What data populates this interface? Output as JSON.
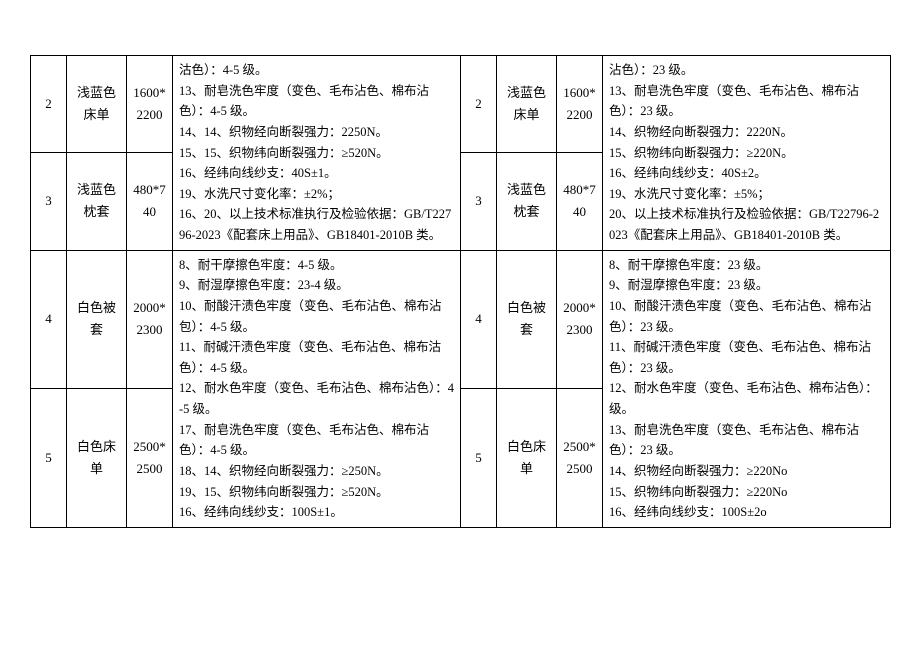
{
  "left_rows": [
    {
      "num": "2",
      "name": "浅蓝色床单",
      "size": "1600*2200",
      "spec": [
        "沽色）：4-5 级。",
        "13、耐皂洗色牢度（变色、毛布沾色、棉布沾色）：4-5 级。",
        "14、14、织物经向断裂强力：2250N。",
        "15、15、织物纬向断裂强力：≥520N。",
        "16、经纬向线纱支：40S±1。"
      ]
    },
    {
      "num": "3",
      "name": "浅蓝色枕套",
      "size": "480*740",
      "spec": [
        "19、水洗尺寸变化率：±2%；",
        "16、20、以上技术标准执行及检验依据：GB/T22796-2023《配套床上用品》、GB18401-2010B 类。"
      ]
    },
    {
      "num": "4",
      "name": "白色被套",
      "size": "2000*2300",
      "spec": [
        "8、耐干摩擦色牢度：4-5 级。",
        "9、耐湿摩擦色牢度：23-4 级。",
        "10、耐酸汗渍色牢度（变色、毛布沾色、棉布沾包）：4-5 级。",
        "11、耐碱汗渍色牢度（变色、毛布沾色、棉布沽色）：4-5 级。"
      ]
    },
    {
      "num": "5",
      "name": "白色床单",
      "size": "2500*2500",
      "spec": [
        "12、耐水色牢度（变色、毛布沾色、棉布沾色）：4-5 级。",
        "17、耐皂洗色牢度（变色、毛布沾色、棉布沾色）：4-5 级。",
        "18、14、织物经向断裂强力：≥250N。",
        "19、15、织物纬向断裂强力：≥520N。",
        "16、经纬向线纱支：100S±1。"
      ]
    }
  ],
  "right_rows": [
    {
      "num": "2",
      "name": "浅蓝色床单",
      "size": "1600*2200",
      "spec": [
        "沾色）：23 级。",
        "13、耐皂洗色牢度（变色、毛布沾色、棉布沾色）：23 级。",
        "14、织物经向断裂强力：2220N。",
        "15、织物纬向断裂强力：≥220N。",
        "16、经纬向线纱支：40S±2。"
      ]
    },
    {
      "num": "3",
      "name": "浅蓝色枕套",
      "size": "480*740",
      "spec": [
        "19、水洗尺寸变化率：±5%；",
        "20、以上技术标准执行及检验依据：GB/T22796-2023《配套床上用品》、GB18401-2010B 类。"
      ]
    },
    {
      "num": "4",
      "name": "白色被套",
      "size": "2000*2300",
      "spec": [
        "8、耐干摩擦色牢度：23 级。",
        "9、耐湿摩擦色牢度：23 级。",
        "10、耐酸汗渍色牢度（变色、毛布沾色、棉布沾色）：23 级。",
        "11、耐碱汗渍色牢度（变色、毛布沾色、棉布沾色）：23 级。"
      ]
    },
    {
      "num": "5",
      "name": "白色床单",
      "size": "2500*2500",
      "spec": [
        "12、耐水色牢度（变色、毛布沾色、棉布沾色）：级。",
        "13、耐皂洗色牢度（变色、毛布沾色、棉布沾色）：23 级。",
        "14、织物经向断裂强力：≥220No",
        "15、织物纬向断裂强力：≥220No",
        "16、经纬向线纱支：100S±2o"
      ]
    }
  ]
}
